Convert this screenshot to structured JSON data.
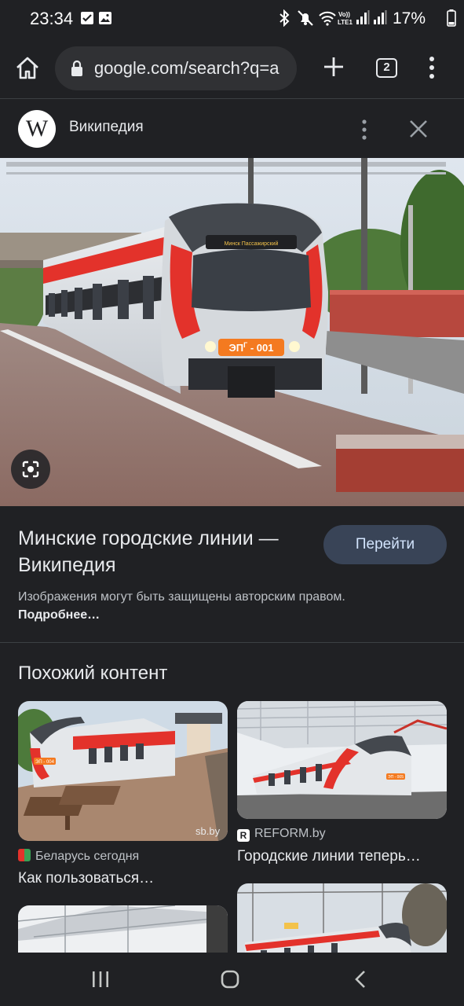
{
  "status_bar": {
    "time": "23:34",
    "battery_percent": "17%",
    "icons": [
      "checkbox-notification-icon",
      "gallery-icon",
      "bluetooth-icon",
      "mute-icon",
      "wifi-icon",
      "volte-icon",
      "signal-icon",
      "battery-icon"
    ]
  },
  "browser": {
    "url": "google.com/search?q=a",
    "tab_count": "2"
  },
  "card": {
    "source_name": "Википедия",
    "logo_letter": "W",
    "title": "Минские городские линии — Википедия",
    "go_button": "Перейти",
    "copyright_note": "Изображения могут быть защищены авторским правом.",
    "more_link": "Подробнее…",
    "train_number": "ЭП",
    "train_number_sup": "Г",
    "train_number_suffix": " - 001",
    "train_dest": "Минск Пассажирский"
  },
  "related": {
    "section_title": "Похожий контент",
    "items": [
      {
        "source": "Беларусь сегодня",
        "caption": "Как пользоваться…",
        "watermark": "sb.by",
        "train_label": "ЭП - 004"
      },
      {
        "source": "REFORM.by",
        "caption": "Городские линии теперь…",
        "train_label": "ЭП - 005"
      },
      {
        "source": "",
        "caption": ""
      },
      {
        "source": "",
        "caption": ""
      }
    ]
  },
  "colors": {
    "background": "#202124",
    "button_bg": "#394457",
    "button_text": "#d2e3fc",
    "train_red": "#e3322b",
    "train_orange": "#f47a20"
  }
}
